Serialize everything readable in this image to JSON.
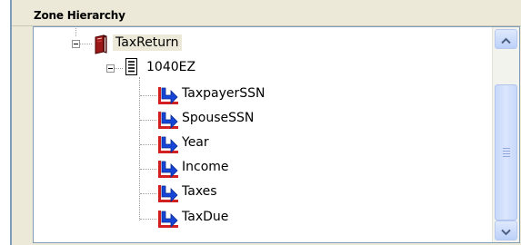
{
  "panel": {
    "title": "Zone Hierarchy"
  },
  "tree": {
    "root": {
      "label": "TaxReturn",
      "icon": "book-icon",
      "expanded": true
    },
    "form": {
      "label": "1040EZ",
      "icon": "document-icon",
      "expanded": true
    },
    "fields": [
      {
        "label": "TaxpayerSSN",
        "icon": "field-arrow-icon"
      },
      {
        "label": "SpouseSSN",
        "icon": "field-arrow-icon"
      },
      {
        "label": "Year",
        "icon": "field-arrow-icon"
      },
      {
        "label": "Income",
        "icon": "field-arrow-icon"
      },
      {
        "label": "Taxes",
        "icon": "field-arrow-icon"
      },
      {
        "label": "TaxDue",
        "icon": "field-arrow-icon"
      }
    ]
  },
  "scrollbar": {
    "up_icon": "chevron-up-icon",
    "down_icon": "chevron-down-icon"
  },
  "colors": {
    "border": "#7f9db9",
    "panel_bg": "#ece9d8",
    "field_icon_blue": "#1646d8",
    "field_icon_red": "#d21f1f"
  }
}
